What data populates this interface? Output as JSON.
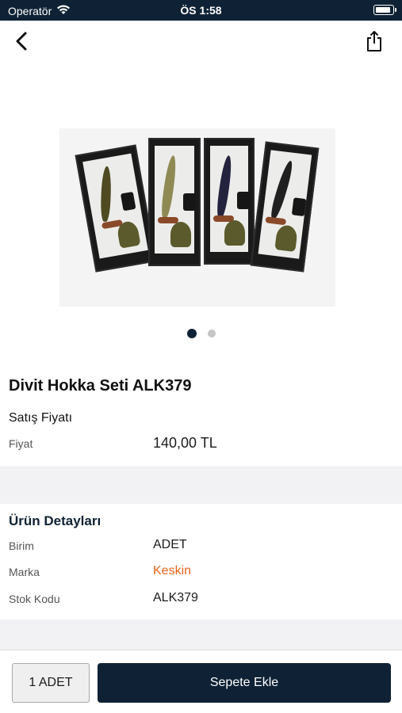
{
  "status_bar": {
    "carrier": "Operatör",
    "time": "ÖS 1:58",
    "wifi_icon": "wifi-icon",
    "battery_icon": "battery-icon",
    "battery_level": 0.9
  },
  "nav": {
    "back_icon": "chevron-left-icon",
    "share_icon": "share-icon"
  },
  "gallery": {
    "image_description_icon": "product-photo",
    "page_count": 2,
    "active_page": 1
  },
  "product": {
    "title": "Divit Hokka Seti ALK379",
    "price_heading": "Satış Fiyatı",
    "price_label": "Fiyat",
    "price_value": "140,00 TL"
  },
  "details": {
    "heading": "Ürün Detayları",
    "rows": [
      {
        "label": "Birim",
        "value": "ADET"
      },
      {
        "label": "Marka",
        "value": "Keskin"
      },
      {
        "label": "Stok Kodu",
        "value": "ALK379"
      }
    ]
  },
  "bottom_bar": {
    "quantity_label": "1 ADET",
    "add_to_cart_label": "Sepete Ekle"
  },
  "colors": {
    "primary": "#0f2235",
    "brand_link": "#e8641c",
    "section_band": "#f2f2f4"
  }
}
